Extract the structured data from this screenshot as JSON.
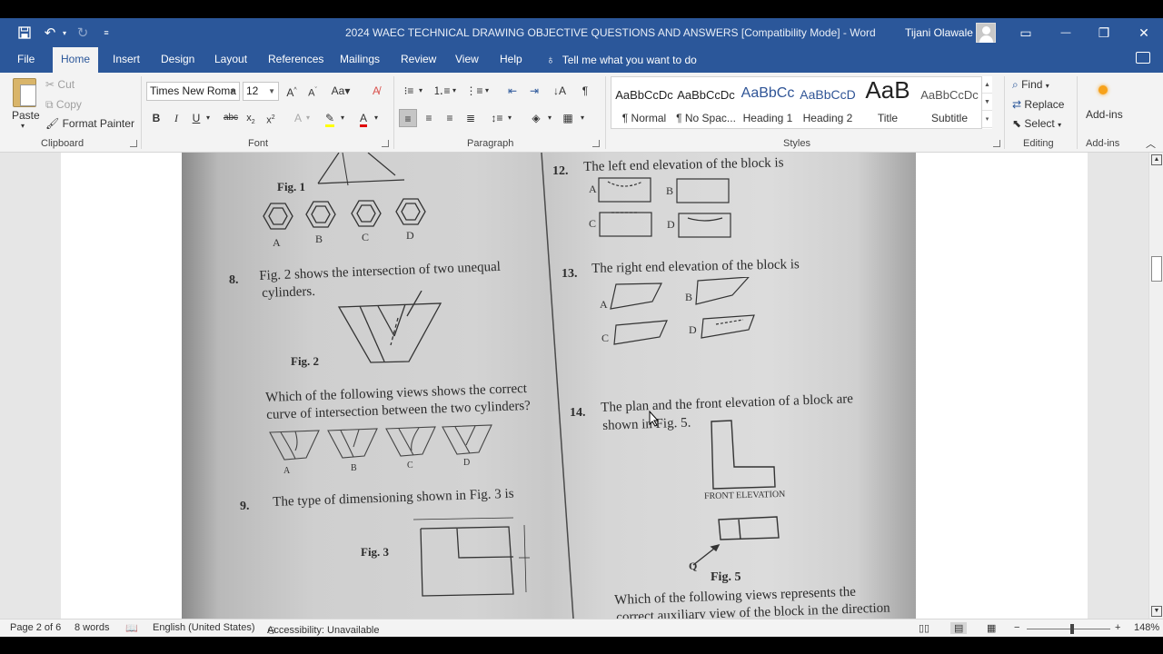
{
  "titlebar": {
    "save_icon": "save-icon",
    "document_title": "2024 WAEC TECHNICAL DRAWING OBJECTIVE QUESTIONS AND ANSWERS [Compatibility Mode]  -  Word",
    "user_name": "Tijani Olawale",
    "controls": {
      "ribbon_display": "▭",
      "minimize": "—",
      "restore": "❐",
      "close": "✕"
    }
  },
  "tabs": [
    "File",
    "Home",
    "Insert",
    "Design",
    "Layout",
    "References",
    "Mailings",
    "Review",
    "View",
    "Help"
  ],
  "active_tab": "Home",
  "tell_me": "Tell me what you want to do",
  "ribbon": {
    "clipboard": {
      "paste": "Paste",
      "cut": "Cut",
      "copy": "Copy",
      "format_painter": "Format Painter",
      "label": "Clipboard"
    },
    "font": {
      "name": "Times New Roma",
      "size": "12",
      "label": "Font"
    },
    "paragraph": {
      "label": "Paragraph"
    },
    "styles": {
      "label": "Styles",
      "items": [
        {
          "preview": "AaBbCcDc",
          "name": "¶ Normal"
        },
        {
          "preview": "AaBbCcDc",
          "name": "¶ No Spac..."
        },
        {
          "preview": "AaBbCc",
          "name": "Heading 1"
        },
        {
          "preview": "AaBbCcD",
          "name": "Heading 2"
        },
        {
          "preview": "AaB",
          "name": "Title"
        },
        {
          "preview": "AaBbCcDc",
          "name": "Subtitle"
        }
      ]
    },
    "editing": {
      "find": "Find",
      "replace": "Replace",
      "select": "Select",
      "label": "Editing"
    },
    "addins": {
      "button": "Add-ins",
      "label": "Add-ins"
    }
  },
  "document": {
    "left": {
      "fig1_label": "Fig. 1",
      "fig1_options": [
        "A",
        "B",
        "C",
        "D"
      ],
      "q8_number": "8.",
      "q8_text_line1": "Fig. 2 shows the intersection of two unequal",
      "q8_text_line2": "cylinders.",
      "fig2_label": "Fig. 2",
      "q8_question_line1": "Which of the following views shows the correct",
      "q8_question_line2": "curve of intersection between the two cylinders?",
      "fig2_options": [
        "A",
        "B",
        "C",
        "D"
      ],
      "q9_number": "9.",
      "q9_text": "The type of dimensioning shown in Fig. 3 is",
      "fig3_label": "Fig. 3"
    },
    "right": {
      "q12_number": "12.",
      "q12_text": "The left end elevation of the block is",
      "q12_options": [
        "A",
        "B",
        "C",
        "D"
      ],
      "q13_number": "13.",
      "q13_text": "The right end elevation of the block is",
      "q13_options": [
        "A",
        "B",
        "C",
        "D"
      ],
      "q14_number": "14.",
      "q14_text_line1": "The plan and the front elevation of a block are",
      "q14_text_line2": "shown in Fig. 5.",
      "front_elevation": "FRONT ELEVATION",
      "q_marker": "Q",
      "fig5_label": "Fig. 5",
      "q14_question_line1": "Which of the following views represents the",
      "q14_question_line2": "correct auxiliary view of the block in the direction"
    }
  },
  "statusbar": {
    "page": "Page 2 of 6",
    "words": "8 words",
    "language": "English (United States)",
    "accessibility": "Accessibility: Unavailable",
    "zoom": "148%"
  }
}
